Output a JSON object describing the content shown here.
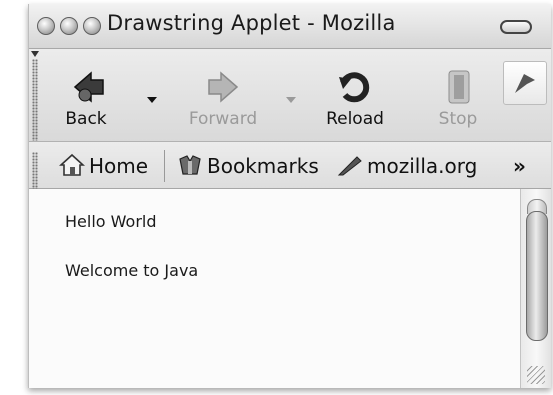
{
  "window": {
    "title": "Drawstring Applet - Mozilla"
  },
  "navigation": {
    "back_label": "Back",
    "forward_label": "Forward",
    "reload_label": "Reload",
    "stop_label": "Stop"
  },
  "bookmarks_bar": {
    "items": [
      {
        "label": "Home",
        "icon": "home-icon"
      },
      {
        "label": "Bookmarks",
        "icon": "bookmarks-icon"
      },
      {
        "label": "mozilla.org",
        "icon": "mozilla-icon"
      }
    ],
    "overflow_label": "»"
  },
  "content": {
    "lines": [
      "Hello World",
      "Welcome to Java"
    ]
  }
}
